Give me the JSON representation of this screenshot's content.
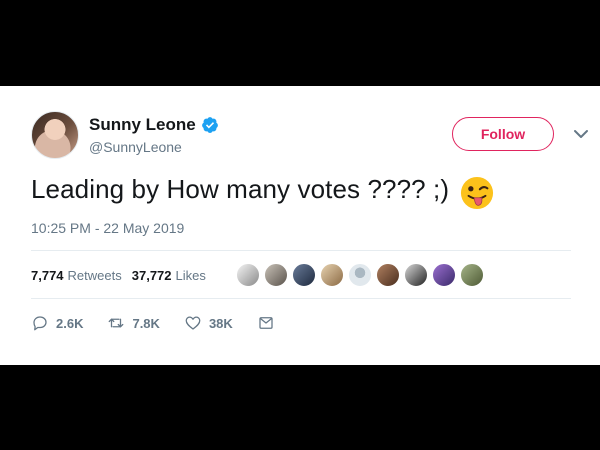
{
  "tweet": {
    "display_name": "Sunny Leone",
    "username": "@SunnyLeone",
    "follow_label": "Follow",
    "text": "Leading by How many votes ???? ;)",
    "emoji": "winking-face-with-tongue",
    "timestamp": "10:25 PM - 22 May 2019",
    "retweets_count": "7,774",
    "retweets_label": "Retweets",
    "likes_count": "37,772",
    "likes_label": "Likes",
    "actions": {
      "replies": "2.6K",
      "retweets": "7.8K",
      "likes": "38K"
    }
  },
  "colors": {
    "follow_accent": "#e0245e",
    "verified": "#1da1f2",
    "secondary_text": "#657786",
    "primary_text": "#14171a"
  }
}
